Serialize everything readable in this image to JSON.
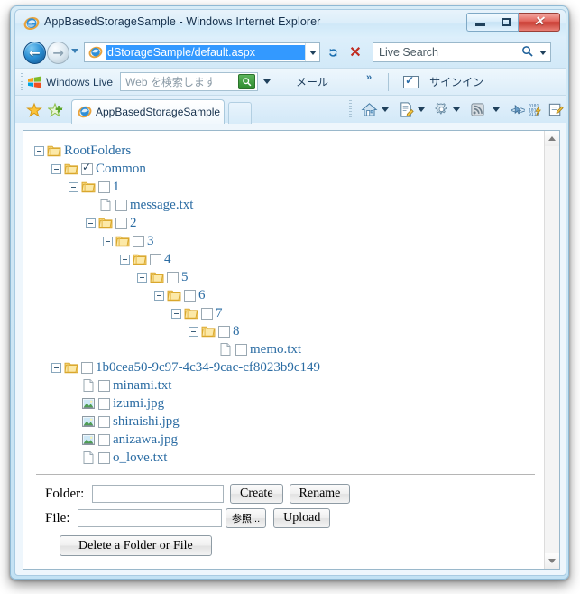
{
  "window": {
    "title": "AppBasedStorageSample - Windows Internet Explorer",
    "app_icon": "ie-logo-icon",
    "minimize_label": "",
    "maximize_label": "",
    "close_label": "✕"
  },
  "navbar": {
    "back_glyph": "←",
    "forward_glyph": "→",
    "address_value": "dStorageSample/default.aspx",
    "address_icon": "ie-logo-icon",
    "refresh_glyph": "↺",
    "stop_glyph": "✕",
    "search_value": "Live Search",
    "search_go_glyph": "⚲"
  },
  "live_bar": {
    "brand": "Windows Live",
    "search_placeholder": "Web を検索します",
    "search_go_glyph": "⚲",
    "mail_label": "メール",
    "overflow_glyph": "»",
    "signin_label": "サインイン"
  },
  "tab_row": {
    "tab_label": "AppBasedStorageSample",
    "tab_icon": "ie-logo-icon"
  },
  "tree": {
    "nodes": [
      {
        "level": 0,
        "expander": true,
        "icon": "folder-icon",
        "checkbox": "none",
        "label": "RootFolders"
      },
      {
        "level": 1,
        "expander": true,
        "icon": "folder-icon",
        "checkbox": "checked",
        "label": "Common"
      },
      {
        "level": 2,
        "expander": true,
        "icon": "folder-icon",
        "checkbox": "unchecked",
        "label": "1"
      },
      {
        "level": 3,
        "expander": false,
        "icon": "text-file-icon",
        "checkbox": "unchecked",
        "label": "message.txt"
      },
      {
        "level": 3,
        "expander": true,
        "icon": "folder-icon",
        "checkbox": "unchecked",
        "label": "2"
      },
      {
        "level": 4,
        "expander": true,
        "icon": "folder-icon",
        "checkbox": "unchecked",
        "label": "3"
      },
      {
        "level": 5,
        "expander": true,
        "icon": "folder-icon",
        "checkbox": "unchecked",
        "label": "4"
      },
      {
        "level": 6,
        "expander": true,
        "icon": "folder-icon",
        "checkbox": "unchecked",
        "label": "5"
      },
      {
        "level": 7,
        "expander": true,
        "icon": "folder-icon",
        "checkbox": "unchecked",
        "label": "6"
      },
      {
        "level": 8,
        "expander": true,
        "icon": "folder-icon",
        "checkbox": "unchecked",
        "label": "7"
      },
      {
        "level": 9,
        "expander": true,
        "icon": "folder-icon",
        "checkbox": "unchecked",
        "label": "8"
      },
      {
        "level": 10,
        "expander": false,
        "icon": "text-file-icon",
        "checkbox": "unchecked",
        "label": "memo.txt"
      },
      {
        "level": 1,
        "expander": true,
        "icon": "folder-icon",
        "checkbox": "unchecked",
        "label": "1b0cea50-9c97-4c34-9cac-cf8023b9c149"
      },
      {
        "level": 2,
        "expander": false,
        "icon": "text-file-icon",
        "checkbox": "unchecked",
        "label": "minami.txt"
      },
      {
        "level": 2,
        "expander": false,
        "icon": "image-file-icon",
        "checkbox": "unchecked",
        "label": "izumi.jpg"
      },
      {
        "level": 2,
        "expander": false,
        "icon": "image-file-icon",
        "checkbox": "unchecked",
        "label": "shiraishi.jpg"
      },
      {
        "level": 2,
        "expander": false,
        "icon": "image-file-icon",
        "checkbox": "unchecked",
        "label": "anizawa.jpg"
      },
      {
        "level": 2,
        "expander": false,
        "icon": "text-file-icon",
        "checkbox": "unchecked",
        "label": "o_love.txt"
      }
    ]
  },
  "form": {
    "folder_label": "Folder:",
    "folder_value": "",
    "folder_placeholder": "",
    "create_label": "Create",
    "rename_label": "Rename",
    "file_label": "File:",
    "file_value": "",
    "file_placeholder": "",
    "browse_label": "参照...",
    "upload_label": "Upload",
    "delete_label": "Delete a Folder or File"
  },
  "colors": {
    "link": "#2b6ca3",
    "selection": "#3399ff",
    "frame": "#c3e2f4"
  }
}
